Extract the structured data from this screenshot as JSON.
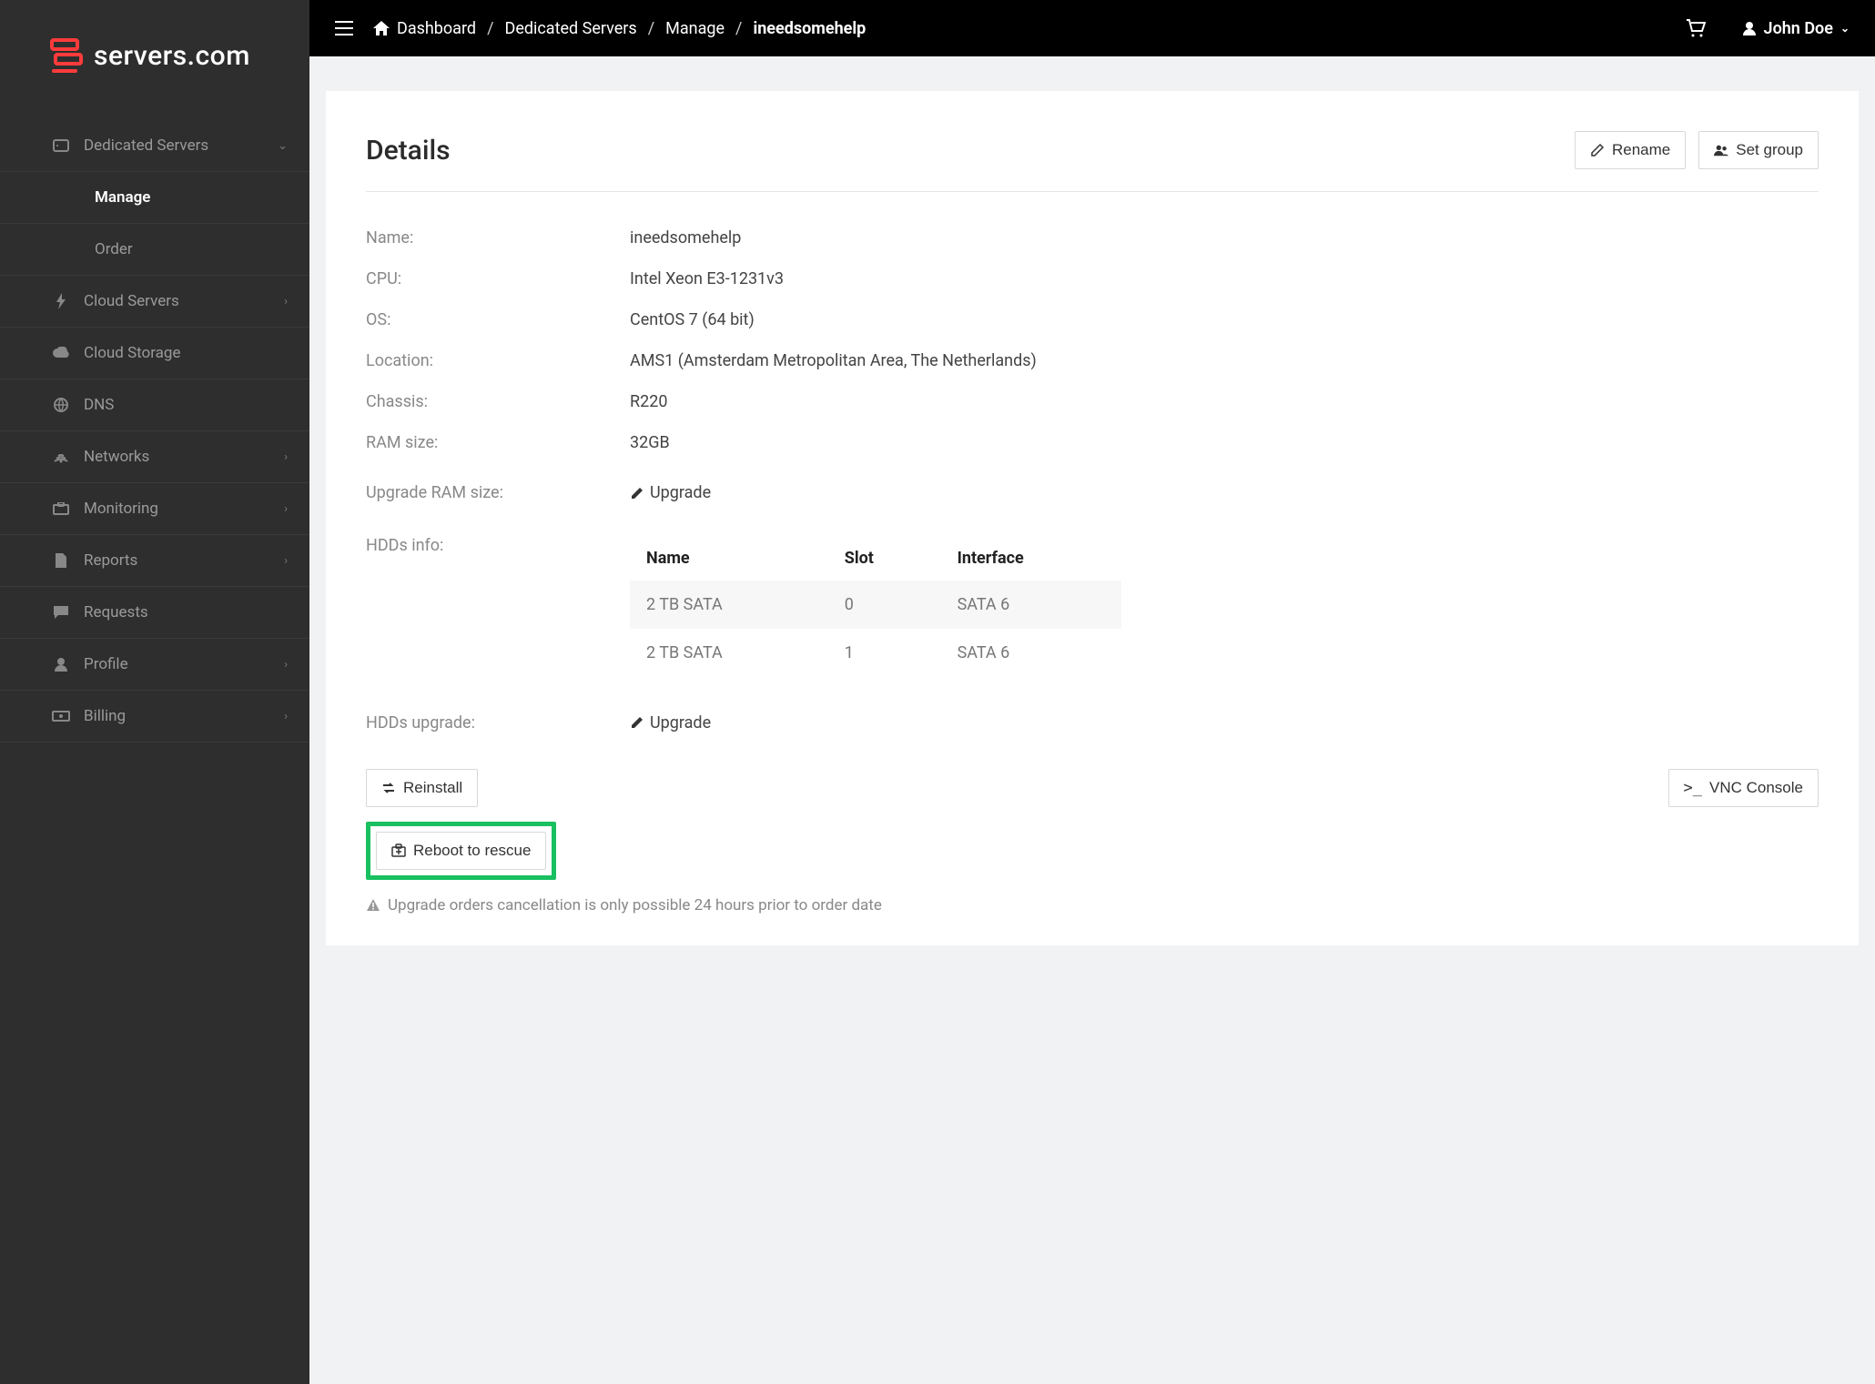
{
  "brand": {
    "name": "servers.com"
  },
  "topbar": {
    "breadcrumbs": {
      "root": "Dashboard",
      "section": "Dedicated Servers",
      "sub": "Manage",
      "current": "ineedsomehelp"
    },
    "user": "John Doe"
  },
  "sidebar": {
    "dedicated": {
      "label": "Dedicated Servers",
      "manage": "Manage",
      "order": "Order"
    },
    "cloud_servers": "Cloud Servers",
    "cloud_storage": "Cloud Storage",
    "dns": "DNS",
    "networks": "Networks",
    "monitoring": "Monitoring",
    "reports": "Reports",
    "requests": "Requests",
    "profile": "Profile",
    "billing": "Billing"
  },
  "details": {
    "title": "Details",
    "buttons": {
      "rename": "Rename",
      "set_group": "Set group"
    },
    "labels": {
      "name": "Name:",
      "cpu": "CPU:",
      "os": "OS:",
      "location": "Location:",
      "chassis": "Chassis:",
      "ram": "RAM size:",
      "upgrade_ram": "Upgrade RAM size:",
      "hdds": "HDDs info:",
      "hdds_upgrade": "HDDs upgrade:"
    },
    "values": {
      "name": "ineedsomehelp",
      "cpu": "Intel Xeon E3-1231v3",
      "os": "CentOS 7 (64 bit)",
      "location": "AMS1 (Amsterdam Metropolitan Area, The Netherlands)",
      "chassis": "R220",
      "ram": "32GB",
      "upgrade_link": "Upgrade",
      "hdd_upgrade_link": "Upgrade"
    },
    "hdd_headers": {
      "name": "Name",
      "slot": "Slot",
      "interface": "Interface"
    },
    "hdds": [
      {
        "name": "2 TB SATA",
        "slot": "0",
        "interface": "SATA 6"
      },
      {
        "name": "2 TB SATA",
        "slot": "1",
        "interface": "SATA 6"
      }
    ],
    "actions": {
      "reinstall": "Reinstall",
      "reboot_rescue": "Reboot to rescue",
      "vnc": "VNC Console"
    },
    "note": "Upgrade orders cancellation is only possible 24 hours prior to order date"
  }
}
